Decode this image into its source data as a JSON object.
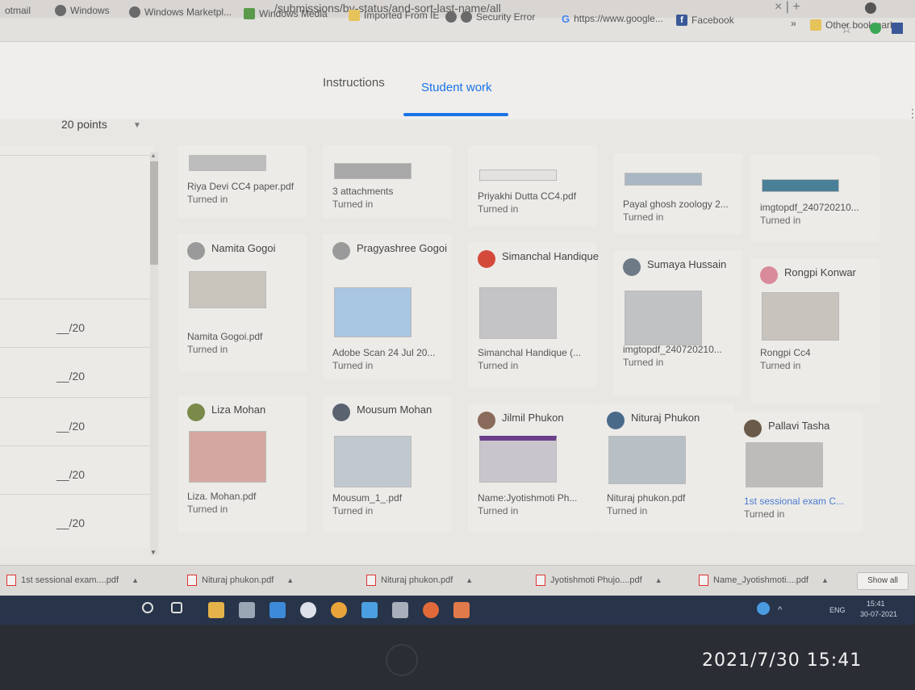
{
  "browser": {
    "url_text": "/submissions/by-status/and-sort-last-name/all",
    "bookmarks": [
      {
        "label": "otmail",
        "icon": "none"
      },
      {
        "label": "Windows",
        "icon": "globe-icon"
      },
      {
        "label": "Windows Marketpl...",
        "icon": "globe-icon"
      },
      {
        "label": "Windows Media",
        "icon": "media-icon"
      },
      {
        "label": "Imported From IE",
        "icon": "folder-icon"
      },
      {
        "label": "Security Error",
        "icon": "globe-icon"
      },
      {
        "label": "https://www.google...",
        "icon": "google-icon"
      },
      {
        "label": "Facebook",
        "icon": "facebook-icon"
      }
    ],
    "more": "»",
    "other_bookmarks": "Other bookmarks"
  },
  "classroom": {
    "tabs": [
      "Instructions",
      "Student work"
    ],
    "active_tab": "Student work",
    "points": "20 points",
    "grades": [
      "__/20",
      "__/20",
      "__/20",
      "__/20",
      "__/20"
    ]
  },
  "cards": [
    {
      "name": "",
      "file": "Riya Devi CC4 paper.pdf",
      "status": "Turned in"
    },
    {
      "name": "",
      "file": "3 attachments",
      "status": "Turned in"
    },
    {
      "name": "",
      "file": "Priyakhi Dutta CC4.pdf",
      "status": "Turned in"
    },
    {
      "name": "",
      "file": "Payal ghosh zoology 2...",
      "status": "Turned in"
    },
    {
      "name": "",
      "file": "imgtopdf_240720210...",
      "status": "Turned in"
    },
    {
      "name": "Namita Gogoi",
      "file": "Namita Gogoi.pdf",
      "status": "Turned in"
    },
    {
      "name": "Pragyashree Gogoi",
      "file": "Adobe Scan 24 Jul 20...",
      "status": "Turned in"
    },
    {
      "name": "Simanchal Handique",
      "file": "Simanchal Handique (...",
      "status": "Turned in"
    },
    {
      "name": "Sumaya Hussain",
      "file": "imgtopdf_240720210...",
      "status": "Turned in"
    },
    {
      "name": "Rongpi Konwar",
      "file": "Rongpi Cc4",
      "status": "Turned in"
    },
    {
      "name": "Liza Mohan",
      "file": "Liza. Mohan.pdf",
      "status": "Turned in"
    },
    {
      "name": "Mousum Mohan",
      "file": "Mousum_1_.pdf",
      "status": "Turned in"
    },
    {
      "name": "Jilmil Phukon",
      "file": "Name:Jyotishmoti Ph...",
      "status": "Turned in"
    },
    {
      "name": "Nituraj Phukon",
      "file": "Nituraj phukon.pdf",
      "status": "Turned in"
    },
    {
      "name": "Pallavi Tasha",
      "file": "1st sessional exam C...",
      "status": "Turned in"
    }
  ],
  "downloads": [
    "1st sessional exam....pdf",
    "Nituraj phukon.pdf",
    "Nituraj phukon.pdf",
    "Jyotishmoti Phujo....pdf",
    "Name_Jyotishmoti....pdf"
  ],
  "show_all": "Show all",
  "taskbar": {
    "lang": "ENG",
    "time": "15:41",
    "date": "30-07-2021"
  },
  "photo_stamp": "2021/7/30  15:41"
}
